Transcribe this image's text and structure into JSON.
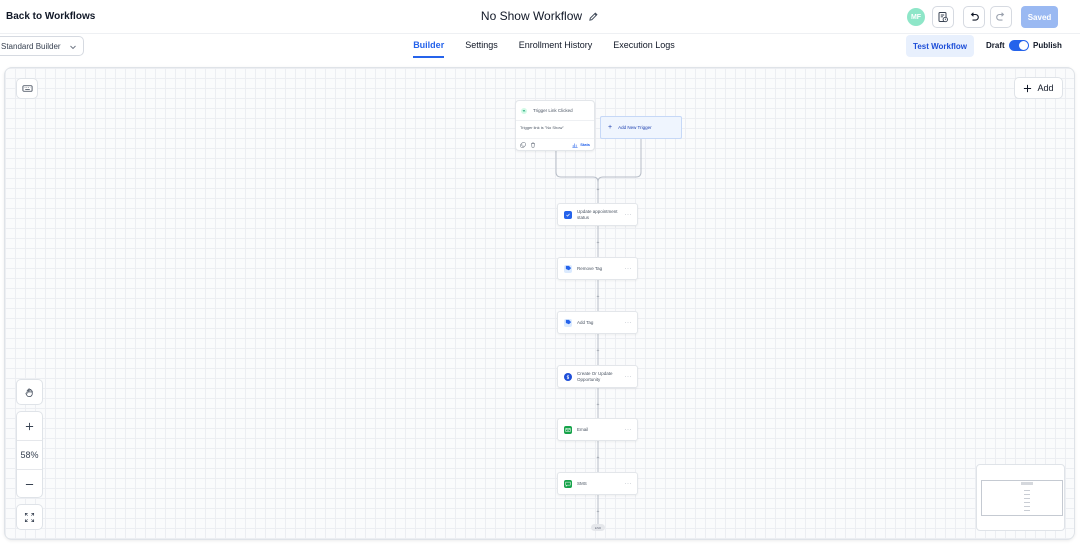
{
  "header": {
    "back_label": "Back to Workflows",
    "workflow_title": "No Show Workflow",
    "avatar_initials": "MF",
    "saved_label": "Saved"
  },
  "subbar": {
    "builder_select": "Standard Builder",
    "tabs": [
      {
        "label": "Builder",
        "active": true
      },
      {
        "label": "Settings",
        "active": false
      },
      {
        "label": "Enrollment History",
        "active": false
      },
      {
        "label": "Execution Logs",
        "active": false
      }
    ],
    "test_label": "Test Workflow",
    "draft_label": "Draft",
    "publish_label": "Publish",
    "publish_on": true
  },
  "canvas": {
    "add_label": "Add",
    "zoom_level": "58%",
    "trigger": {
      "title": "Trigger Link Clicked",
      "filter": "Trigger link is \"No Show\"",
      "stats_label": "Stats"
    },
    "new_trigger_label": "Add New Trigger",
    "actions": [
      {
        "label": "Update appointment status",
        "icon": "calendar-check-icon",
        "color": "#2563eb"
      },
      {
        "label": "Remove Tag",
        "icon": "tag-icon",
        "color": "#2563eb"
      },
      {
        "label": "Add Tag",
        "icon": "tag-icon",
        "color": "#2563eb"
      },
      {
        "label": "Create Or Update Opportunity",
        "icon": "dollar-icon",
        "color": "#1d4ed8"
      },
      {
        "label": "Email",
        "icon": "mail-icon",
        "color": "#16a34a"
      },
      {
        "label": "SMS",
        "icon": "chat-icon",
        "color": "#16a34a"
      }
    ],
    "end_label": "END"
  }
}
